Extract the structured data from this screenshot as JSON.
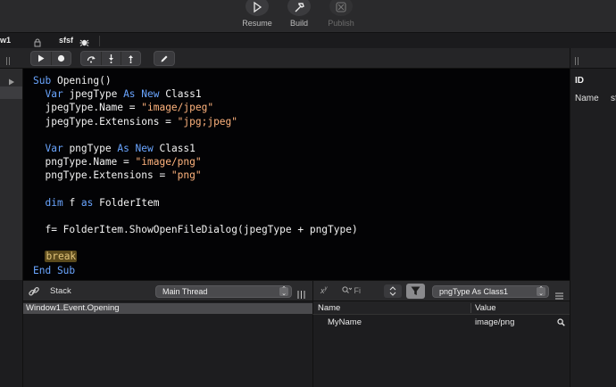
{
  "toolbar": {
    "resume_label": "Resume",
    "build_label": "Build",
    "publish_label": "Publish"
  },
  "tabs": {
    "window_tab_label": "w1",
    "sfsf_tab_label": "sfsf"
  },
  "code": {
    "lines": [
      {
        "t": [
          {
            "c": "kw",
            "s": "Sub"
          },
          {
            "c": "",
            "s": " Opening()"
          }
        ]
      },
      {
        "t": [
          {
            "c": "",
            "s": "  "
          },
          {
            "c": "kw",
            "s": "Var"
          },
          {
            "c": "",
            "s": " jpegType "
          },
          {
            "c": "kw",
            "s": "As New"
          },
          {
            "c": "",
            "s": " Class1"
          }
        ]
      },
      {
        "t": [
          {
            "c": "",
            "s": "  jpegType.Name = "
          },
          {
            "c": "str",
            "s": "\"image/jpeg\""
          }
        ]
      },
      {
        "t": [
          {
            "c": "",
            "s": "  jpegType.Extensions = "
          },
          {
            "c": "str",
            "s": "\"jpg;jpeg\""
          }
        ]
      },
      {
        "t": [
          {
            "c": "",
            "s": ""
          }
        ]
      },
      {
        "t": [
          {
            "c": "",
            "s": "  "
          },
          {
            "c": "kw",
            "s": "Var"
          },
          {
            "c": "",
            "s": " pngType "
          },
          {
            "c": "kw",
            "s": "As New"
          },
          {
            "c": "",
            "s": " Class1"
          }
        ]
      },
      {
        "t": [
          {
            "c": "",
            "s": "  pngType.Name = "
          },
          {
            "c": "str",
            "s": "\"image/png\""
          }
        ]
      },
      {
        "t": [
          {
            "c": "",
            "s": "  pngType.Extensions = "
          },
          {
            "c": "str",
            "s": "\"png\""
          }
        ]
      },
      {
        "t": [
          {
            "c": "",
            "s": ""
          }
        ]
      },
      {
        "t": [
          {
            "c": "",
            "s": "  "
          },
          {
            "c": "kw",
            "s": "dim"
          },
          {
            "c": "",
            "s": " f "
          },
          {
            "c": "kw",
            "s": "as"
          },
          {
            "c": "",
            "s": " FolderItem"
          }
        ]
      },
      {
        "t": [
          {
            "c": "",
            "s": ""
          }
        ]
      },
      {
        "t": [
          {
            "c": "",
            "s": "  f= FolderItem.ShowOpenFileDialog(jpegType + pngType)"
          }
        ]
      },
      {
        "t": [
          {
            "c": "",
            "s": ""
          }
        ]
      },
      {
        "t": [
          {
            "c": "",
            "s": "  "
          },
          {
            "c": "brk",
            "s": "break"
          }
        ]
      },
      {
        "t": [
          {
            "c": "kw",
            "s": "End Sub"
          }
        ]
      }
    ]
  },
  "stack": {
    "title": "Stack",
    "thread_popup": "Main Thread",
    "frames": [
      "Window1.Event.Opening"
    ]
  },
  "variables": {
    "find_placeholder": "Fi",
    "scope_popup": "pngType As Class1",
    "col_name": "Name",
    "col_value": "Value",
    "rows": [
      {
        "name": "MyName",
        "value": "image/png"
      }
    ]
  },
  "inspector": {
    "id_label": "ID",
    "name_label": "Name",
    "name_value": "sf"
  },
  "colors": {
    "keyword": "#6aa5ff",
    "string": "#ffb37d",
    "break_bg": "#5b4a1c"
  }
}
